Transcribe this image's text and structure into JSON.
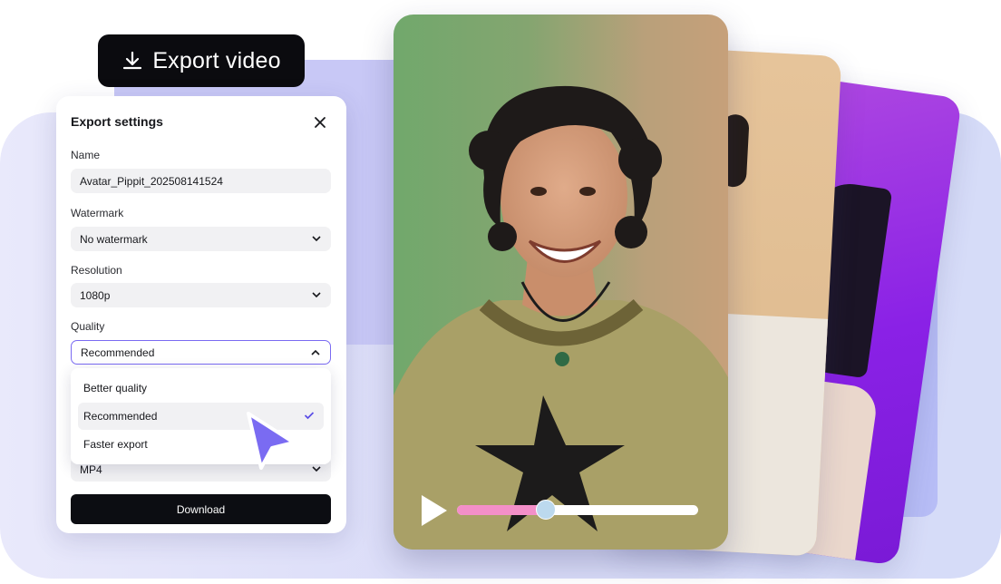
{
  "export_button": {
    "label": "Export video",
    "icon": "download-icon"
  },
  "panel": {
    "title": "Export settings",
    "close_icon": "close-icon",
    "fields": {
      "name": {
        "label": "Name",
        "value": "Avatar_Pippit_202508141524"
      },
      "watermark": {
        "label": "Watermark",
        "value": "No watermark"
      },
      "resolution": {
        "label": "Resolution",
        "value": "1080p"
      },
      "quality": {
        "label": "Quality",
        "value": "Recommended",
        "options": [
          "Better quality",
          "Recommended",
          "Faster export"
        ],
        "selected": "Recommended"
      },
      "format": {
        "value": "MP4"
      }
    },
    "download_label": "Download"
  },
  "video": {
    "progress": 0.37,
    "colors": {
      "fill": "#f38fc8",
      "thumb": "#bcd9ee",
      "track": "#ffffff"
    }
  },
  "theme": {
    "accent": "#7a6bf2",
    "cursor": "#7a6bf2",
    "dark": "#0b0b0f"
  }
}
